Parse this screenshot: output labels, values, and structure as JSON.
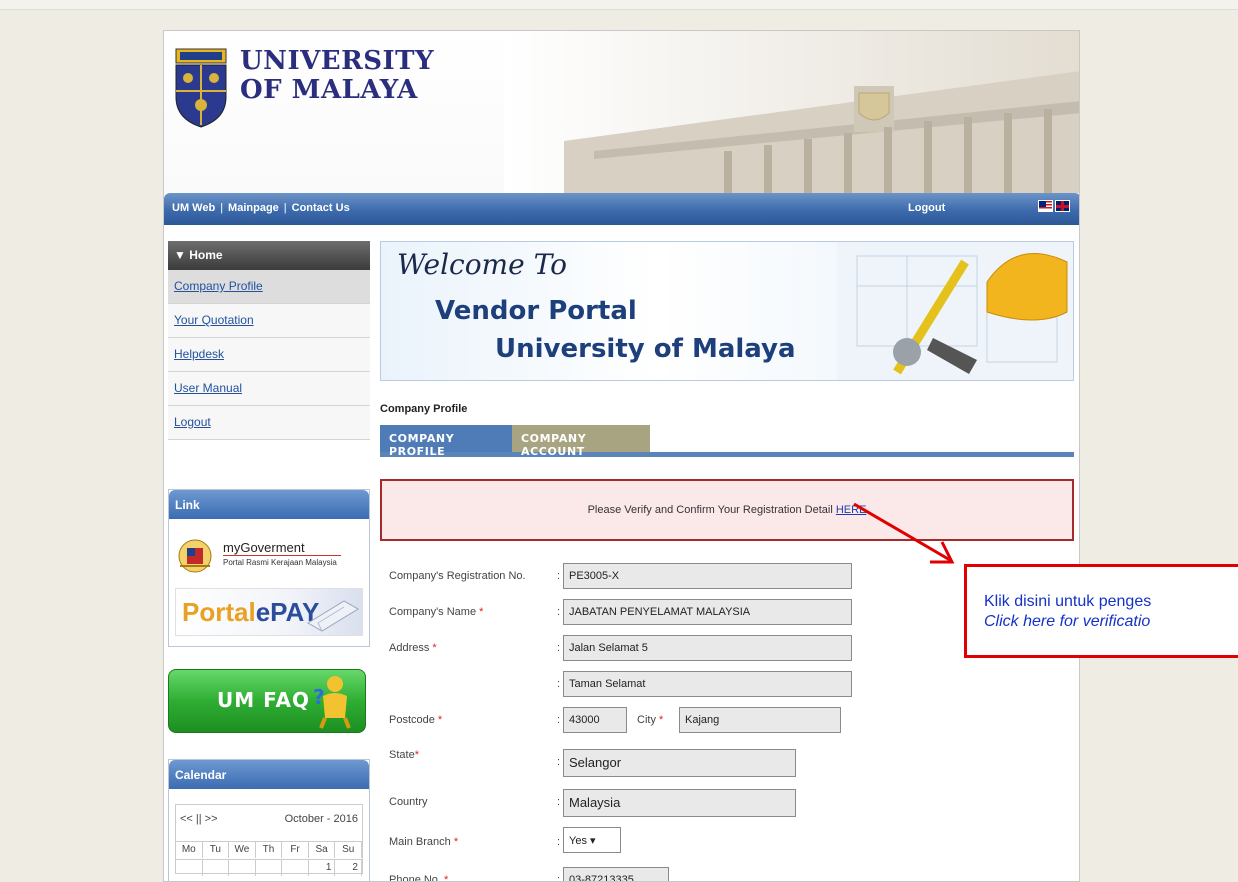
{
  "header": {
    "university_line1": "UNIVERSITY",
    "university_line2": "OF MALAYA"
  },
  "navbar": {
    "links": [
      "UM Web",
      "Mainpage",
      "Contact Us"
    ],
    "logout": "Logout"
  },
  "sidebar": {
    "home": "▼ Home",
    "items": [
      "Company Profile",
      "Your Quotation",
      "Helpdesk",
      "User Manual",
      "Logout"
    ]
  },
  "link_box": {
    "title": "Link",
    "mygov_title": "myGoverment",
    "mygov_sub": "Portal Rasmi Kerajaan Malaysia",
    "epay_part1": "Portal",
    "epay_part2": "ePAY",
    "faq": "UM FAQ"
  },
  "calendar": {
    "title": "Calendar",
    "nav": "<< || >>",
    "month": "October - 2016",
    "days": [
      "Mo",
      "Tu",
      "We",
      "Th",
      "Fr",
      "Sa",
      "Su"
    ],
    "dates": [
      "",
      "",
      "",
      "",
      "",
      "1",
      "2"
    ]
  },
  "banner": {
    "welcome": "Welcome To",
    "line1": "Vendor Portal",
    "line2": "University of Malaya"
  },
  "content": {
    "section_label": "Company Profile",
    "tabs": [
      "COMPANY PROFILE",
      "COMPANY ACCOUNT"
    ],
    "verify_text": "Please Verify and Confirm Your Registration Detail ",
    "verify_link": "HERE"
  },
  "form": {
    "reg_label": "Company's Registration No.",
    "reg_value": "PE3005-X",
    "name_label": "Company's Name ",
    "name_value": "JABATAN PENYELAMAT MALAYSIA",
    "address_label": "Address ",
    "address1": "Jalan Selamat 5",
    "address2": "Taman Selamat",
    "postcode_label": "Postcode ",
    "postcode_value": "43000",
    "city_label": "City ",
    "city_value": "Kajang",
    "state_label": "State",
    "state_value": "Selangor",
    "country_label": "Country",
    "country_value": "Malaysia",
    "branch_label": "Main Branch ",
    "branch_value": "Yes ▾",
    "phone_label": "Phone No. ",
    "phone_value": "03-87213335",
    "required_mark": "*",
    "colon": ":"
  },
  "annotation": {
    "malay": "Klik disini untuk penges",
    "english": "Click here for verificatio"
  },
  "colors": {
    "nav_blue": "#3c6aac",
    "tab_active": "#4f7bb7",
    "tab_inactive": "#a8a380",
    "alert_border": "#a52a2a",
    "annotation_red": "#e00000",
    "annotation_text": "#1431c8"
  }
}
